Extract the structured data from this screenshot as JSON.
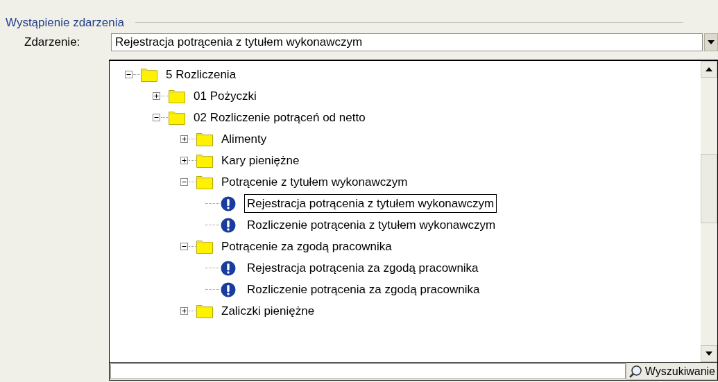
{
  "section": {
    "title": "Wystąpienie zdarzenia"
  },
  "event_field": {
    "label": "Zdarzenie:",
    "value": "Rejestracja potrącenia z tytułem wykonawczym"
  },
  "tree": [
    {
      "kind": "folder",
      "label": "5 Rozliczenia",
      "expanded": true,
      "selected": false,
      "children": [
        {
          "kind": "folder",
          "label": "01 Pożyczki",
          "expanded": false,
          "selected": false
        },
        {
          "kind": "folder",
          "label": "02 Rozliczenie potrąceń od netto",
          "expanded": true,
          "selected": false,
          "children": [
            {
              "kind": "folder",
              "label": "Alimenty",
              "expanded": false,
              "selected": false
            },
            {
              "kind": "folder",
              "label": "Kary pieniężne",
              "expanded": false,
              "selected": false
            },
            {
              "kind": "folder",
              "label": "Potrącenie z tytułem wykonawczym",
              "expanded": true,
              "selected": false,
              "children": [
                {
                  "kind": "event",
                  "label": "Rejestracja potrącenia z tytułem wykonawczym",
                  "selected": true
                },
                {
                  "kind": "event",
                  "label": "Rozliczenie potrącenia z tytułem wykonawczym",
                  "selected": false
                }
              ]
            },
            {
              "kind": "folder",
              "label": "Potrącenie za zgodą pracownika",
              "expanded": true,
              "selected": false,
              "children": [
                {
                  "kind": "event",
                  "label": "Rejestracja potrącenia za zgodą pracownika",
                  "selected": false
                },
                {
                  "kind": "event",
                  "label": "Rozliczenie potrącenia za zgodą pracownika",
                  "selected": false
                }
              ]
            },
            {
              "kind": "folder",
              "label": "Zaliczki pieniężne",
              "expanded": false,
              "selected": false
            }
          ]
        }
      ]
    }
  ],
  "search": {
    "button": "Wyszukiwanie"
  }
}
